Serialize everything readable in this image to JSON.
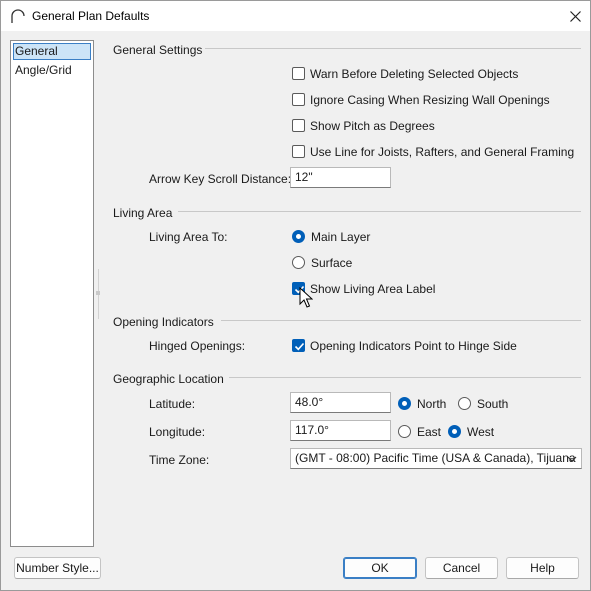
{
  "window": {
    "title": "General Plan Defaults"
  },
  "sidebar": {
    "items": [
      {
        "label": "General",
        "selected": true
      },
      {
        "label": "Angle/Grid",
        "selected": false
      }
    ]
  },
  "general_settings": {
    "header": "General Settings",
    "warn_delete": {
      "label": "Warn Before Deleting Selected Objects",
      "checked": false
    },
    "ignore_casing": {
      "label": "Ignore Casing When Resizing Wall Openings",
      "checked": false
    },
    "show_pitch": {
      "label": "Show Pitch as Degrees",
      "checked": false
    },
    "use_line": {
      "label": "Use Line for Joists, Rafters, and General Framing",
      "checked": false
    },
    "arrow_key": {
      "label": "Arrow Key Scroll Distance:",
      "value": "12\""
    }
  },
  "living_area": {
    "header": "Living Area",
    "to_label": "Living Area To:",
    "main_layer": {
      "label": "Main Layer",
      "checked": true
    },
    "surface": {
      "label": "Surface",
      "checked": false
    },
    "show_label": {
      "label": "Show Living Area Label",
      "checked": true
    }
  },
  "opening_indicators": {
    "header": "Opening Indicators",
    "hinged_label": "Hinged Openings:",
    "point_to_hinge": {
      "label": "Opening Indicators Point to Hinge Side",
      "checked": true
    }
  },
  "geographic": {
    "header": "Geographic Location",
    "latitude": {
      "label": "Latitude:",
      "value": "48.0°"
    },
    "north": {
      "label": "North",
      "checked": true
    },
    "south": {
      "label": "South",
      "checked": false
    },
    "longitude": {
      "label": "Longitude:",
      "value": "117.0°"
    },
    "east": {
      "label": "East",
      "checked": false
    },
    "west": {
      "label": "West",
      "checked": true
    },
    "timezone": {
      "label": "Time Zone:",
      "value": "(GMT - 08:00) Pacific Time (USA & Canada), Tijuana"
    }
  },
  "buttons": {
    "number_style": "Number Style...",
    "ok": "OK",
    "cancel": "Cancel",
    "help": "Help"
  },
  "colors": {
    "accent": "#005fb8",
    "selection": "#cce4f7"
  },
  "icons": {
    "app": "arch-icon",
    "close": "close-icon",
    "dropdown": "chevron-down-icon",
    "cursor": "mouse-pointer-icon"
  }
}
